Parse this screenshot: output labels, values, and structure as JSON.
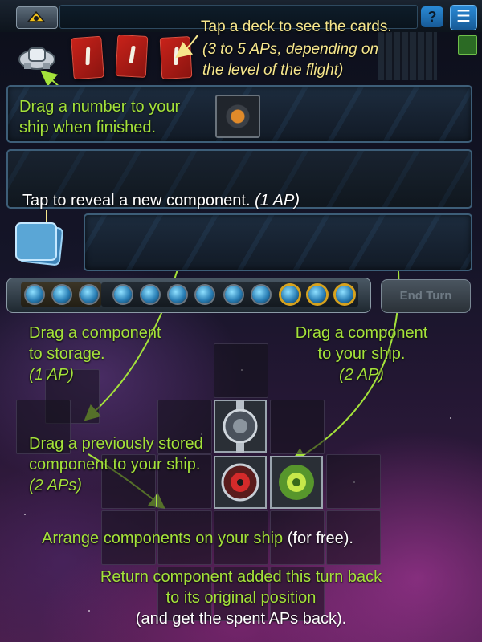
{
  "top_bar": {
    "help_label": "?"
  },
  "tips": {
    "deck_line1": "Tap a deck to see the cards.",
    "deck_line2": "(3 to 5 APs, depending on",
    "deck_line3": "the level of the flight)",
    "drag_number_line1": "Drag a number to your",
    "drag_number_line2": "ship when finished.",
    "reveal_text": "Tap to reveal a new component.",
    "reveal_ap": "(1 AP)",
    "storage_line1": "Drag a component",
    "storage_line2": "to storage.",
    "storage_ap": "(1 AP)",
    "ship_line1": "Drag a component",
    "ship_line2": "to your ship.",
    "ship_ap": "(2 AP)",
    "stored_line1": "Drag a previously stored",
    "stored_line2": "component to your ship.",
    "stored_ap": "(2 APs)",
    "arrange_text": "Arrange components on your ship",
    "arrange_free": "(for free).",
    "return_line1": "Return component added this turn back",
    "return_line2": "to its original position",
    "return_line3": "(and get the spent APs back)."
  },
  "action_points": {
    "total": 12,
    "spent_section": 3,
    "highlighted": 3
  },
  "end_turn_label": "End Turn",
  "colors": {
    "tip_green": "#a4e23a",
    "tip_yellow": "#f6e68c",
    "deck_red": "#c8221a",
    "menu_blue": "#2a8ad6"
  }
}
